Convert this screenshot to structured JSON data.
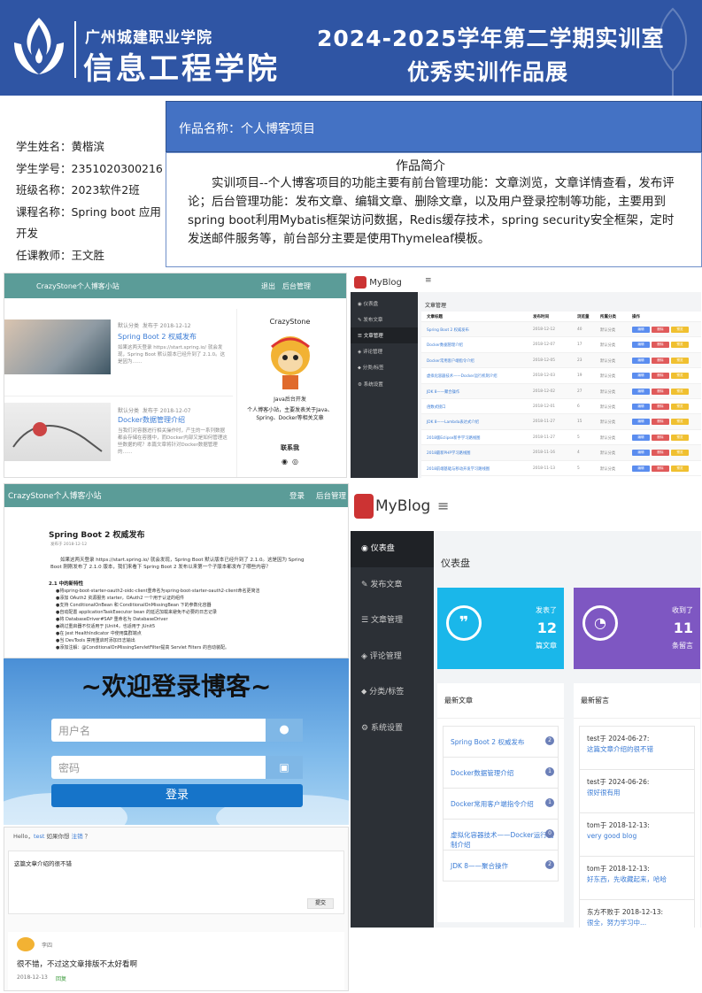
{
  "banner": {
    "school": "广州城建职业学院",
    "college": "信息工程学院",
    "title_line1": "2024-2025学年第二学期实训室",
    "title_line2": "优秀实训作品展"
  },
  "student": {
    "name": "学生姓名：黄楷滨",
    "id": "学生学号：2351020300216",
    "class": "班级名称：2023软件2班",
    "course": "课程名称：Spring boot 应用开发",
    "teacher": "任课教师：王文胜"
  },
  "work": {
    "title": "作品名称：个人博客项目",
    "intro_heading": "作品简介",
    "intro_text": "实训项目--个人博客项目的功能主要有前台管理功能：文章浏览，文章详情查看，发布评论；后台管理功能：发布文章、编辑文章、删除文章，以及用户登录控制等功能，主要用到spring boot利用Mybatis框架访问数据，Redis缓存技术，spring security安全框架，定时发送邮件服务等，前台部分主要是使用Thymeleaf模板。"
  },
  "blog_front": {
    "site_name": "CrazyStone个人博客小站",
    "nav_logout": "退出",
    "nav_admin": "后台管理",
    "posts": [
      {
        "category": "默认分类",
        "date": "发布于 2018-12-12",
        "title": "Spring Boot 2 权威发布",
        "summary": "如果这两天登录 https://start.spring.io/ 就会发现，Spring Boot 默认版本已经升到了 2.1.0。这是因为……"
      },
      {
        "category": "默认分类",
        "date": "发布于 2018-12-07",
        "title": "Docker数据管理介绍",
        "summary": "当我们对容器进行相关操作时，产生的一系列数据都会存储在容器中，而Docker内部又是如何管理这些数据的呢？本篇文章将针对Docker数据管理的……"
      }
    ],
    "profile_name": "CrazyStone",
    "profile_role": "Java后台开发",
    "profile_desc": "个人博客小站，主要发表关于Java、Spring、Docker等相关文章",
    "contact": "联系我"
  },
  "admin_list": {
    "brand": "MyBlog",
    "menu": [
      "仪表盘",
      "发布文章",
      "文章管理",
      "评论管理",
      "分类/标签",
      "系统设置"
    ],
    "panel_title": "文章管理",
    "columns": [
      "文章标题",
      "发布时间",
      "浏览量",
      "所属分类",
      "操作"
    ],
    "rows": [
      [
        "Spring Boot 2 权威发布",
        "2018-12-12",
        "40",
        "默认分类"
      ],
      [
        "Docker数据管理介绍",
        "2018-12-07",
        "17",
        "默认分类"
      ],
      [
        "Docker常用客户端指令介绍",
        "2018-12-05",
        "23",
        "默认分类"
      ],
      [
        "虚拟化容器技术——Docker运行机制介绍",
        "2018-12-03",
        "19",
        "默认分类"
      ],
      [
        "JDK 8——聚合操作",
        "2018-12-02",
        "27",
        "默认分类"
      ],
      [
        "函数式接口",
        "2018-12-01",
        "6",
        "默认分类"
      ],
      [
        "JDK 8——Lambda表达式介绍",
        "2018-11-27",
        "15",
        "默认分类"
      ],
      [
        "2018版Eclipse新手学习路线图",
        "2018-11-27",
        "5",
        "默认分类"
      ],
      [
        "2018最新PHP学习路线图",
        "2018-11-16",
        "4",
        "默认分类"
      ],
      [
        "2018前端基础与移动开发学习路线图",
        "2018-11-13",
        "5",
        "默认分类"
      ]
    ],
    "actions": [
      "编辑",
      "删除",
      "预览"
    ]
  },
  "article": {
    "site_name": "CrazyStone个人博客小站",
    "nav_login": "登录",
    "nav_admin": "后台管理",
    "title": "Spring Boot 2 权威发布",
    "date": "发布于 2018-12-12",
    "intro": "如果这两天登录 https://start.spring.io/ 就会发现，Spring Boot 默认版本已经升到了 2.1.0。这是因为 Spring Boot 刚刚发布了 2.1.0 版本，我们来看下 Spring Boot 2 发布以来第一个子版本都发布了哪些内容？",
    "section": "2.1 中的新特性",
    "bullets": [
      "●将spring-boot-starter-oauth2-oidc-client重命名为spring-boot-starter-oauth2-client命名更简洁",
      "●添加 OAuth2 资源服务 starter，OAuth2 一个用于认证的组件",
      "●支持 ConditionalOnBean 和 ConditionalOnMissingBean 下的参数化容器",
      "●自动配置 applicationTaskExecutor bean 的延迟加载来避免不必要的日志记录",
      "●将 DatabaseDriver#SAP 重命名为 DatabaseDriver",
      "●跳过重启器不仅适用于 JUnit4，也适用于 JUnit5",
      "●在 Jest HealthIndicator 中使用集群端点",
      "●当 DevTools 禁用重启时添加日志输出",
      "●添加注解：@ConditionalOnMissingServletFilter提高 Servlet Filters 的自动装配。"
    ]
  },
  "dashboard": {
    "brand": "MyBlog",
    "menu": [
      "仪表盘",
      "发布文章",
      "文章管理",
      "评论管理",
      "分类/标签",
      "系统设置"
    ],
    "title": "仪表盘",
    "stat1_label": "发表了",
    "stat1_value": "12",
    "stat1_unit": "篇文章",
    "stat2_label": "收到了",
    "stat2_value": "11",
    "stat2_unit": "条留言",
    "latest_articles_title": "最新文章",
    "latest_articles": [
      {
        "title": "Spring Boot 2 权威发布",
        "count": "2"
      },
      {
        "title": "Docker数据管理介绍",
        "count": "1"
      },
      {
        "title": "Docker常用客户端指令介绍",
        "count": "1"
      },
      {
        "title": "虚拟化容器技术——Docker运行机制介绍",
        "count": "0"
      },
      {
        "title": "JDK 8——聚合操作",
        "count": "2"
      }
    ],
    "latest_comments_title": "最新留言",
    "latest_comments": [
      {
        "meta": "test于 2024-06-27:",
        "text": "这篇文章介绍的很不错"
      },
      {
        "meta": "test于 2024-06-26:",
        "text": "很好很有用"
      },
      {
        "meta": "tom于 2018-12-13:",
        "text": "very good blog"
      },
      {
        "meta": "tom于 2018-12-13:",
        "text": "好东西，先收藏起来，哈哈"
      },
      {
        "meta": "东方不败于 2018-12-13:",
        "text": "很全，努力学习中..."
      }
    ],
    "colors": {
      "stat1": "#1ab7ea",
      "stat2": "#7e57c2",
      "side": "#2c3036"
    }
  },
  "login": {
    "title": "~欢迎登录博客~",
    "username_placeholder": "用户名",
    "password_placeholder": "密码",
    "submit": "登录"
  },
  "comments": {
    "hello": "Hello，",
    "user": "test",
    "not_you": " 如果你想 ",
    "logout": "注销",
    "tail": " ？",
    "draft": "这篇文章介绍的很不错",
    "submit": "提交",
    "author": "李四",
    "text": "很不错，不过这文章排版不太好看啊",
    "date": "2018-12-13",
    "reply": "回复"
  }
}
